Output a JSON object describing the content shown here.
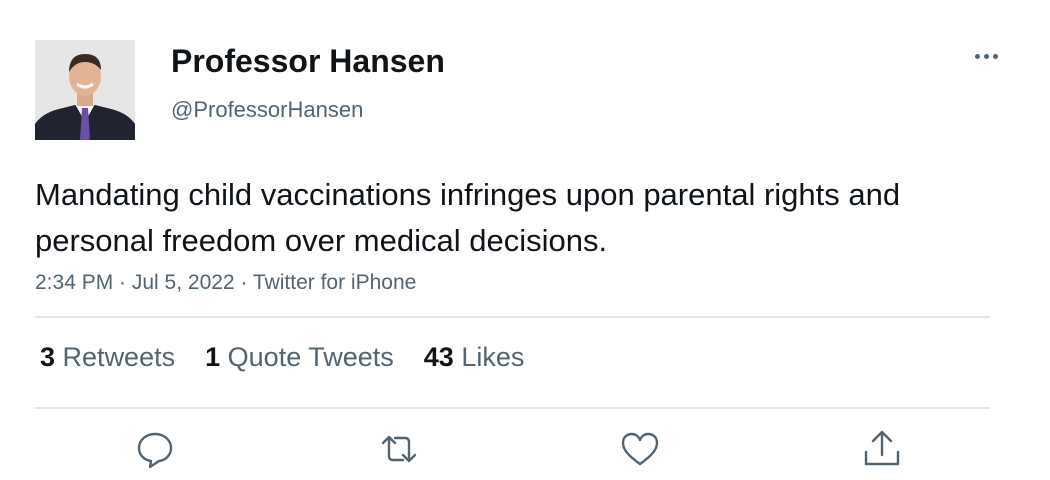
{
  "author": {
    "name": "Professor Hansen",
    "handle": "@ProfessorHansen",
    "avatar_icon": "profile-photo"
  },
  "more_icon": "more-horizontal-icon",
  "tweet": {
    "text": "Mandating child vaccinations infringes upon parental rights and personal freedom over medical decisions.",
    "meta": "2:34 PM · Jul 5, 2022 · Twitter for iPhone"
  },
  "stats": [
    {
      "count": "3",
      "label": "Retweets"
    },
    {
      "count": "1",
      "label": "Quote Tweets"
    },
    {
      "count": "43",
      "label": "Likes"
    }
  ],
  "actions": [
    {
      "icon": "reply-icon"
    },
    {
      "icon": "retweet-icon"
    },
    {
      "icon": "like-icon"
    },
    {
      "icon": "share-icon"
    }
  ],
  "colors": {
    "text": "#0f1419",
    "secondary": "#536471",
    "divider": "#e1e6ea"
  }
}
